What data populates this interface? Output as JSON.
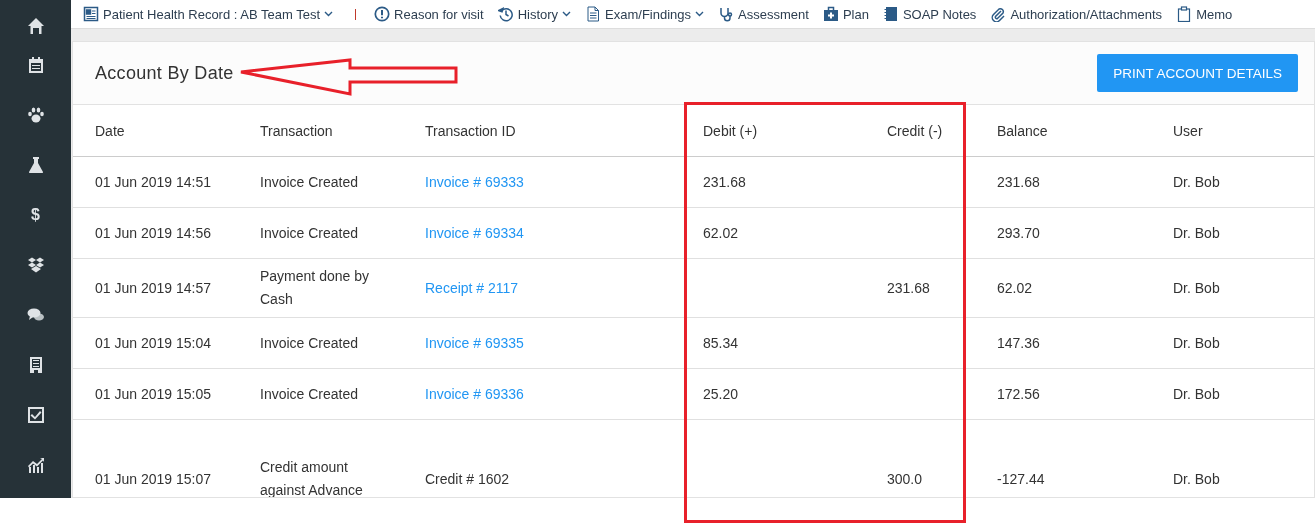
{
  "sidebar": {
    "items": [
      {
        "kind": "home"
      },
      {
        "kind": "calendar"
      },
      {
        "kind": "paw"
      },
      {
        "kind": "flask"
      },
      {
        "kind": "glyph",
        "glyph": "$"
      },
      {
        "kind": "boxes"
      },
      {
        "kind": "chat"
      },
      {
        "kind": "building"
      },
      {
        "kind": "check"
      },
      {
        "kind": "chart"
      }
    ]
  },
  "toolbar": {
    "items": [
      {
        "kind": "record",
        "label": "Patient Health Record : AB Team Test",
        "dropdown": true,
        "separator_after": true
      },
      {
        "kind": "alert",
        "label": "Reason for visit",
        "dropdown": false,
        "separator_after": false
      },
      {
        "kind": "history",
        "label": "History",
        "dropdown": true,
        "separator_after": false
      },
      {
        "kind": "document",
        "label": "Exam/Findings",
        "dropdown": true,
        "separator_after": false
      },
      {
        "kind": "stethoscope",
        "label": "Assessment",
        "dropdown": false,
        "separator_after": false
      },
      {
        "kind": "medkit",
        "label": "Plan",
        "dropdown": false,
        "separator_after": false
      },
      {
        "kind": "notebook",
        "label": "SOAP Notes",
        "dropdown": false,
        "separator_after": false
      },
      {
        "kind": "paperclip",
        "label": "Authorization/Attachments",
        "dropdown": false,
        "separator_after": false
      },
      {
        "kind": "clipboard",
        "label": "Memo",
        "dropdown": false,
        "separator_after": false
      }
    ]
  },
  "card": {
    "title": "Account By Date",
    "print_button": "PRINT ACCOUNT DETAILS"
  },
  "table": {
    "columns": [
      "Date",
      "Transaction",
      "Transaction ID",
      "Debit (+)",
      "Credit (-)",
      "Balance",
      "User"
    ],
    "rows": [
      {
        "date": "01 Jun 2019 14:51",
        "transaction": "Invoice Created",
        "transaction_id": "Invoice # 69333",
        "id_is_link": true,
        "debit": "231.68",
        "credit": "",
        "balance": "231.68",
        "user": "Dr. Bob"
      },
      {
        "date": "01 Jun 2019 14:56",
        "transaction": "Invoice Created",
        "transaction_id": "Invoice # 69334",
        "id_is_link": true,
        "debit": "62.02",
        "credit": "",
        "balance": "293.70",
        "user": "Dr. Bob"
      },
      {
        "date": "01 Jun 2019 14:57",
        "transaction": "Payment done by Cash",
        "transaction_id": "Receipt # 2117",
        "id_is_link": true,
        "debit": "",
        "credit": "231.68",
        "balance": "62.02",
        "user": "Dr. Bob"
      },
      {
        "date": "01 Jun 2019 15:04",
        "transaction": "Invoice Created",
        "transaction_id": "Invoice # 69335",
        "id_is_link": true,
        "debit": "85.34",
        "credit": "",
        "balance": "147.36",
        "user": "Dr. Bob"
      },
      {
        "date": "01 Jun 2019 15:05",
        "transaction": "Invoice Created",
        "transaction_id": "Invoice # 69336",
        "id_is_link": true,
        "debit": "25.20",
        "credit": "",
        "balance": "172.56",
        "user": "Dr. Bob"
      },
      {
        "date": "01 Jun 2019 15:07",
        "transaction": "Credit amount against Advance",
        "transaction_id": "Credit # 1602",
        "id_is_link": false,
        "debit": "",
        "credit": "300.0",
        "balance": "-127.44",
        "user": "Dr. Bob"
      }
    ]
  }
}
